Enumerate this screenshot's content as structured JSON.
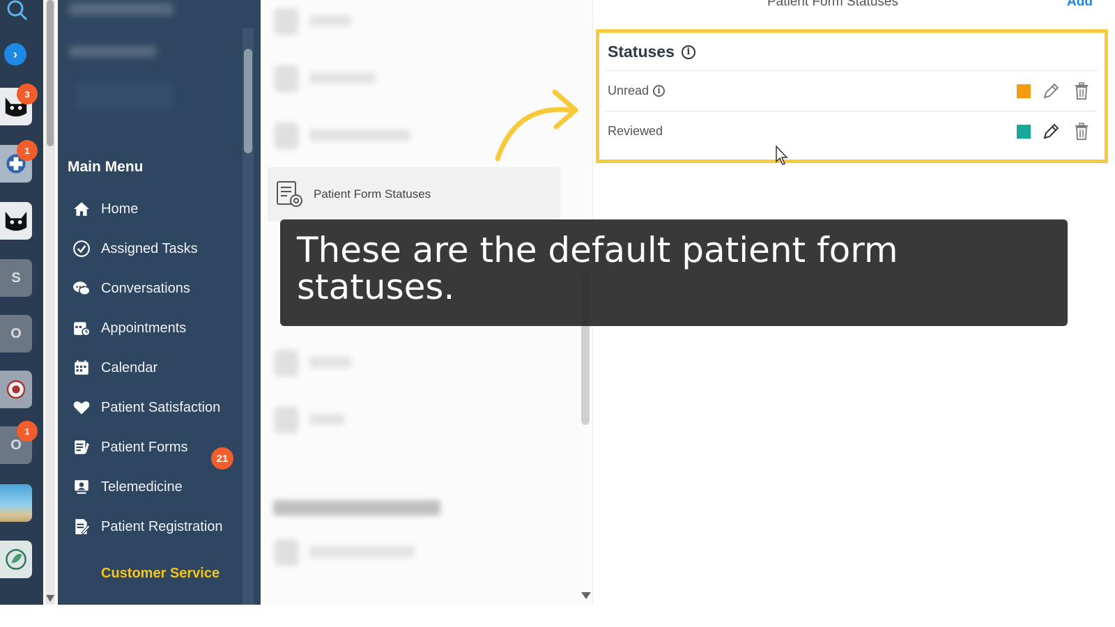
{
  "account_strip": {
    "badges": [
      "3",
      "1",
      "1"
    ],
    "letters": [
      "S",
      "O",
      "O"
    ]
  },
  "sidebar": {
    "menu_title": "Main Menu",
    "items": [
      {
        "label": "Home",
        "icon": "home-icon"
      },
      {
        "label": "Assigned Tasks",
        "icon": "check-circle-icon"
      },
      {
        "label": "Conversations",
        "icon": "chat-bubbles-icon"
      },
      {
        "label": "Appointments",
        "icon": "appointment-calendar-icon"
      },
      {
        "label": "Calendar",
        "icon": "calendar-icon"
      },
      {
        "label": "Patient Satisfaction",
        "icon": "heart-icon"
      },
      {
        "label": "Patient Forms",
        "icon": "forms-icon"
      },
      {
        "label": "Telemedicine",
        "icon": "telemedicine-icon"
      },
      {
        "label": "Patient Registration",
        "icon": "registration-icon"
      }
    ],
    "forms_badge": "21",
    "customer_service": "Customer Service"
  },
  "settings_list": {
    "active_item": "Patient Form Statuses"
  },
  "detail": {
    "title": "Patient Form Statuses",
    "add_label": "Add",
    "section_title": "Statuses",
    "statuses": [
      {
        "name": "Unread",
        "color": "#f39c12"
      },
      {
        "name": "Reviewed",
        "color": "#1aa89a"
      }
    ]
  },
  "caption": {
    "text": "These are the default patient form statuses."
  },
  "colors": {
    "highlight": "#f8c93a",
    "sidebar_bg": "#2e4660",
    "accent": "#1e88e5",
    "badge": "#f25d2c"
  }
}
